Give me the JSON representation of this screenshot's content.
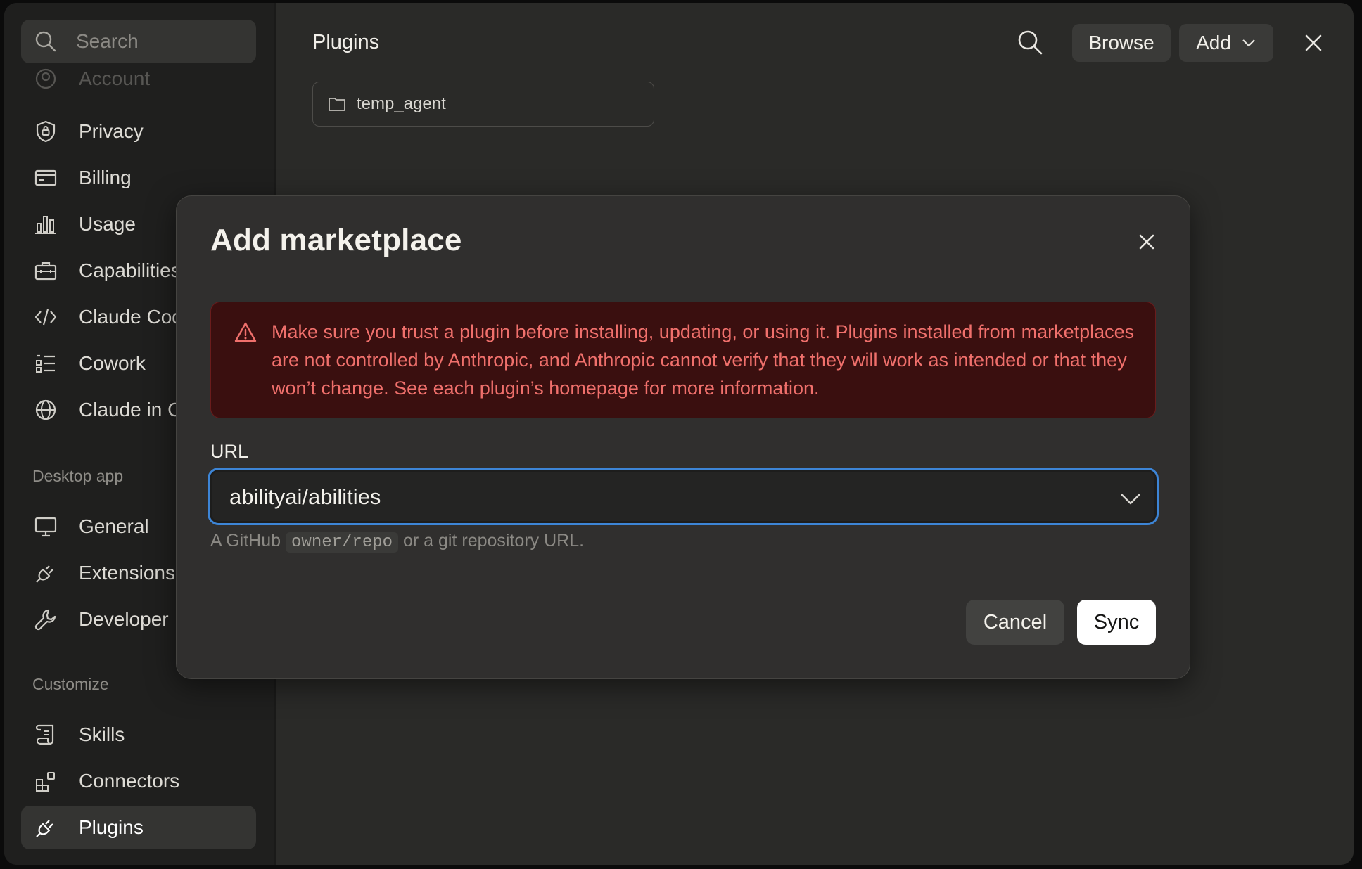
{
  "sidebar": {
    "search_placeholder": "Search",
    "items_top": [
      {
        "label": "Account",
        "icon": "user-circle-icon"
      },
      {
        "label": "Privacy",
        "icon": "shield-lock-icon"
      },
      {
        "label": "Billing",
        "icon": "credit-card-icon"
      },
      {
        "label": "Usage",
        "icon": "bar-chart-icon"
      },
      {
        "label": "Capabilities",
        "icon": "briefcase-icon"
      },
      {
        "label": "Claude Code",
        "icon": "code-icon"
      },
      {
        "label": "Cowork",
        "icon": "checklist-icon"
      },
      {
        "label": "Claude in Chrome",
        "icon": "globe-icon"
      }
    ],
    "section_desktop": "Desktop app",
    "items_desktop": [
      {
        "label": "General",
        "icon": "monitor-icon"
      },
      {
        "label": "Extensions",
        "icon": "plug-icon"
      },
      {
        "label": "Developer",
        "icon": "wrench-icon"
      }
    ],
    "section_customize": "Customize",
    "items_customize": [
      {
        "label": "Skills",
        "icon": "scroll-icon"
      },
      {
        "label": "Connectors",
        "icon": "grid-plus-icon"
      },
      {
        "label": "Plugins",
        "icon": "plug-icon",
        "active": true
      }
    ]
  },
  "main": {
    "title": "Plugins",
    "browse_label": "Browse",
    "add_label": "Add",
    "folder_chip": "temp_agent"
  },
  "modal": {
    "title": "Add marketplace",
    "warning": "Make sure you trust a plugin before installing, updating, or using it. Plugins installed from marketplaces are not controlled by Anthropic, and Anthropic cannot verify that they will work as intended or that they won’t change. See each plugin’s homepage for more information.",
    "url_label": "URL",
    "url_value": "abilityai/abilities",
    "helper_prefix": "A GitHub",
    "helper_code": "owner/repo",
    "helper_suffix": "or a git repository URL.",
    "cancel_label": "Cancel",
    "sync_label": "Sync"
  },
  "colors": {
    "accent_focus": "#3d85d6",
    "warning_bg": "#3a0f0f",
    "warning_text": "#f0706c",
    "primary_button": "#ffffff"
  }
}
